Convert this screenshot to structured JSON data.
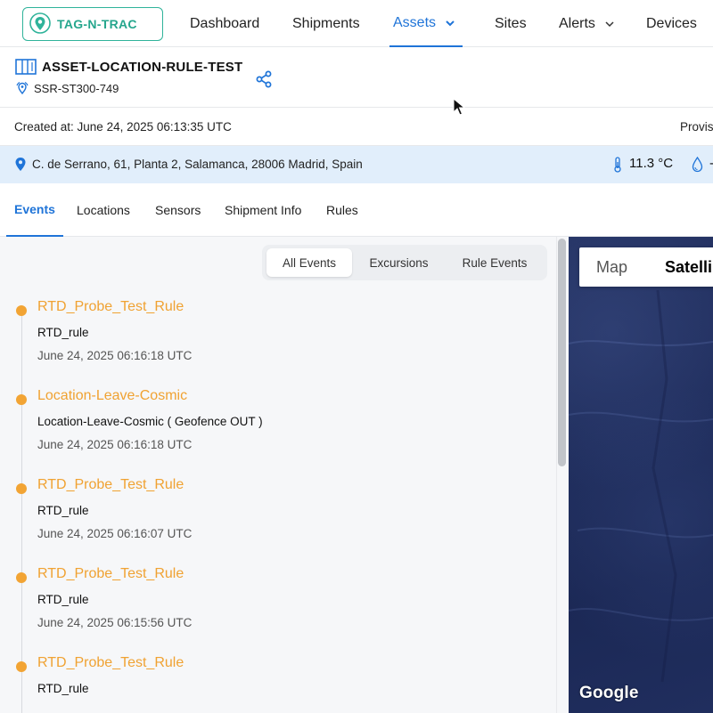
{
  "brand": {
    "logo_text": "TAG-N-TRAC",
    "color": "#25a68d"
  },
  "nav": {
    "items": [
      {
        "label": "Dashboard"
      },
      {
        "label": "Shipments"
      },
      {
        "label": "Assets"
      },
      {
        "label": "Sites"
      },
      {
        "label": "Alerts"
      },
      {
        "label": "Devices"
      }
    ],
    "active": "Assets"
  },
  "asset": {
    "title": "ASSET-LOCATION-RULE-TEST",
    "device": "SSR-ST300-749"
  },
  "info": {
    "created": "Created at: June 24, 2025 06:13:35 UTC",
    "provisioned": "Provis"
  },
  "location": {
    "address": "C. de Serrano, 61, Planta 2, Salamanca, 28006 Madrid, Spain",
    "temperature": "11.3 °C",
    "humidity": "-"
  },
  "tabs": [
    {
      "label": "Events"
    },
    {
      "label": "Locations"
    },
    {
      "label": "Sensors"
    },
    {
      "label": "Shipment Info"
    },
    {
      "label": "Rules"
    }
  ],
  "filters": [
    {
      "label": "All Events"
    },
    {
      "label": "Excursions"
    },
    {
      "label": "Rule Events"
    }
  ],
  "events": [
    {
      "title": "RTD_Probe_Test_Rule",
      "desc": "RTD_rule",
      "time": "June 24, 2025 06:16:18 UTC"
    },
    {
      "title": "Location-Leave-Cosmic",
      "desc": "Location-Leave-Cosmic ( Geofence OUT )",
      "time": "June 24, 2025 06:16:18 UTC"
    },
    {
      "title": "RTD_Probe_Test_Rule",
      "desc": "RTD_rule",
      "time": "June 24, 2025 06:16:07 UTC"
    },
    {
      "title": "RTD_Probe_Test_Rule",
      "desc": "RTD_rule",
      "time": "June 24, 2025 06:15:56 UTC"
    },
    {
      "title": "RTD_Probe_Test_Rule",
      "desc": "RTD_rule",
      "time": ""
    }
  ],
  "map": {
    "type_map": "Map",
    "type_satellite": "Satelli",
    "attribution": "Google"
  },
  "colors": {
    "accent": "#1f74d8",
    "event": "#f2a434",
    "location_bar": "#e1eefb"
  }
}
